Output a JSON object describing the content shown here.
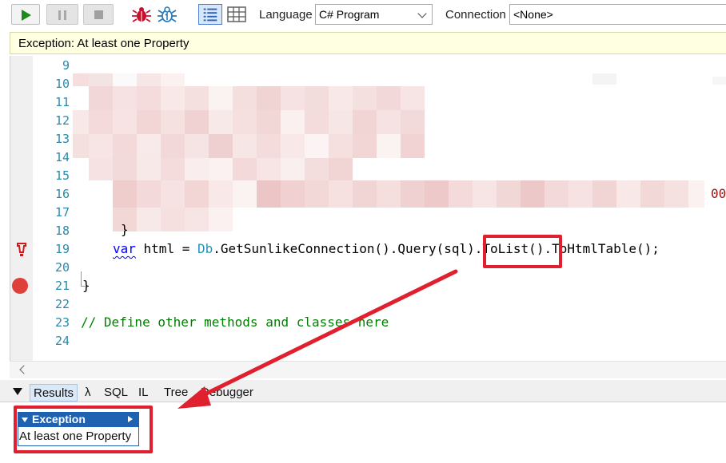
{
  "toolbar": {
    "run_icon": "play-icon",
    "pause_icon": "pause-icon",
    "stop_icon": "stop-icon",
    "language_label": "Language",
    "language_value": "C# Program",
    "connection_label": "Connection",
    "connection_value": "<None>"
  },
  "exception_bar": {
    "text": "Exception: At least one Property"
  },
  "editor": {
    "line_numbers": [
      "9",
      "10",
      "11",
      "12",
      "13",
      "14",
      "15",
      "16",
      "17",
      "18",
      "19",
      "20",
      "21",
      "22",
      "23",
      "24"
    ],
    "line16_fragment": "00",
    "line18_text": "}",
    "line19": {
      "keyword": "var",
      "rest_a": " html = ",
      "class": "Db",
      "rest_b": ".GetSunlikeConnection().Query(sql).ToList().ToHtmlTable();"
    },
    "line21_text": "}",
    "line23_comment": "// Define other methods and classes here"
  },
  "result_tabs": [
    "Results",
    "λ",
    "SQL",
    "IL",
    "Tree",
    "Debugger"
  ],
  "results": {
    "header": "Exception",
    "message": "At least one Property"
  },
  "colors": {
    "annotation": "#e0202e",
    "exception_header": "#1f62b1",
    "breakpoint": "#e0403a",
    "exception_bar_bg": "#ffffe1"
  }
}
